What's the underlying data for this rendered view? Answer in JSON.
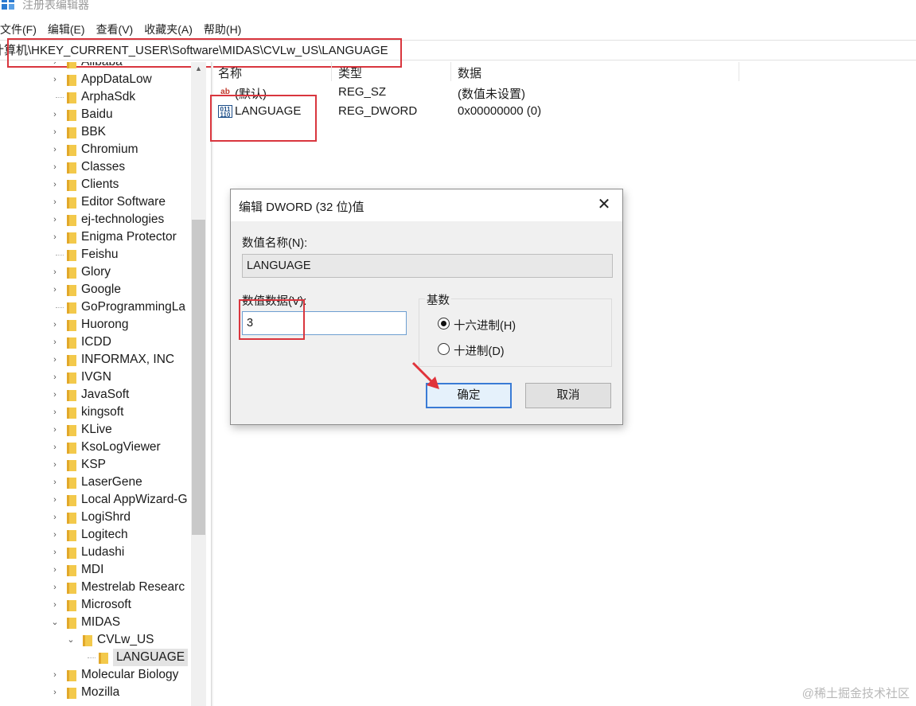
{
  "window": {
    "title": "注册表编辑器"
  },
  "menu": [
    "文件(F)",
    "编辑(E)",
    "查看(V)",
    "收藏夹(A)",
    "帮助(H)"
  ],
  "address": {
    "path": "计算机\\HKEY_CURRENT_USER\\Software\\MIDAS\\CVLw_US\\LANGUAGE"
  },
  "tree": {
    "items": [
      "Alibaba",
      "AppDataLow",
      "ArphaSdk",
      "Baidu",
      "BBK",
      "Chromium",
      "Classes",
      "Clients",
      "Editor Software",
      "ej-technologies",
      "Enigma Protector",
      "Feishu",
      "Glory",
      "Google",
      "GoProgrammingLa",
      "Huorong",
      "ICDD",
      "INFORMAX, INC",
      "IVGN",
      "JavaSoft",
      "kingsoft",
      "KLive",
      "KsoLogViewer",
      "KSP",
      "LaserGene",
      "Local AppWizard-G",
      "LogiShrd",
      "Logitech",
      "Ludashi",
      "MDI",
      "Mestrelab Researc",
      "Microsoft",
      "MIDAS",
      "CVLw_US",
      "LANGUAGE",
      "Molecular Biology",
      "Mozilla"
    ]
  },
  "values_table": {
    "columns": [
      "名称",
      "类型",
      "数据"
    ],
    "rows": [
      {
        "name": "(默认)",
        "type": "REG_SZ",
        "data": "(数值未设置)",
        "icon": "string-value-icon"
      },
      {
        "name": "LANGUAGE",
        "type": "REG_DWORD",
        "data": "0x00000000 (0)",
        "icon": "binary-value-icon"
      }
    ]
  },
  "dialog": {
    "title": "编辑 DWORD (32 位)值",
    "close_label": "✕",
    "value_name_label": "数值名称(N):",
    "value_name": "LANGUAGE",
    "value_data_label": "数值数据(V):",
    "value_data": "3",
    "radix_label": "基数",
    "radix_options": [
      "十六进制(H)",
      "十进制(D)"
    ],
    "radix_selected": "十六进制(H)",
    "ok_label": "确定",
    "cancel_label": "取消"
  },
  "watermark": "@稀土掘金技术社区",
  "colors": {
    "highlight_box": "#d9363e",
    "folder": "#f3c94b",
    "default_button_border": "#3a7bd5"
  }
}
